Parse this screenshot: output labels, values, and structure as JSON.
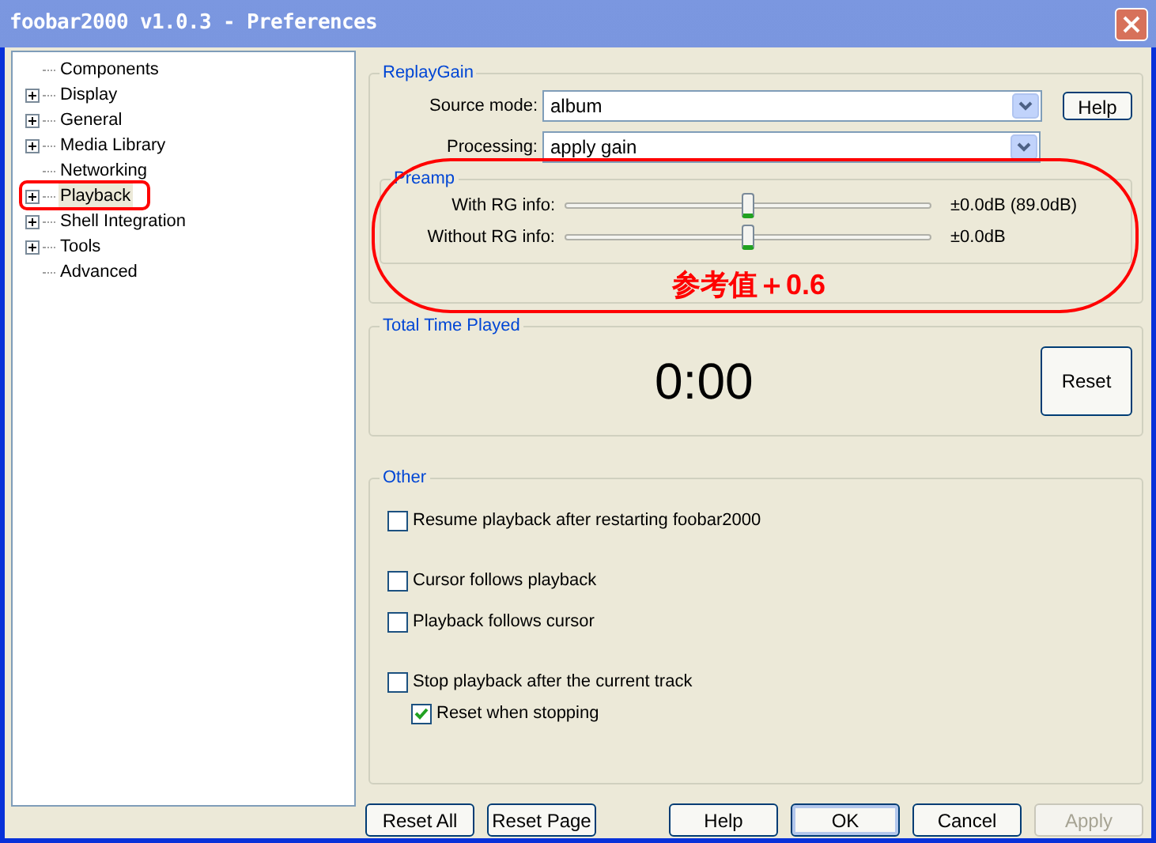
{
  "window": {
    "title": "foobar2000 v1.0.3 - Preferences"
  },
  "tree": [
    {
      "label": "Components",
      "expandable": false,
      "selected": false
    },
    {
      "label": "Display",
      "expandable": true,
      "selected": false
    },
    {
      "label": "General",
      "expandable": true,
      "selected": false
    },
    {
      "label": "Media Library",
      "expandable": true,
      "selected": false
    },
    {
      "label": "Networking",
      "expandable": false,
      "selected": false
    },
    {
      "label": "Playback",
      "expandable": true,
      "selected": true
    },
    {
      "label": "Shell Integration",
      "expandable": true,
      "selected": false
    },
    {
      "label": "Tools",
      "expandable": true,
      "selected": false
    },
    {
      "label": "Advanced",
      "expandable": false,
      "selected": false
    }
  ],
  "replaygain": {
    "title": "ReplayGain",
    "source_mode": {
      "label": "Source mode:",
      "value": "album"
    },
    "help": "Help",
    "processing": {
      "label": "Processing:",
      "value": "apply gain"
    },
    "preamp": {
      "title": "Preamp",
      "sliders": [
        {
          "label": "With RG info:",
          "level": 0.5,
          "reading": "±0.0dB (89.0dB)"
        },
        {
          "label": "Without RG info:",
          "level": 0.5,
          "reading": "±0.0dB"
        }
      ]
    }
  },
  "total_time": {
    "title": "Total Time Played",
    "value": "0:00",
    "reset": "Reset"
  },
  "other": {
    "title": "Other",
    "options": [
      {
        "label": "Resume playback after restarting foobar2000",
        "checked": false
      },
      {
        "label": "Cursor follows playback",
        "checked": false
      },
      {
        "label": "Playback follows cursor",
        "checked": false
      },
      {
        "label": "Stop playback after the current track",
        "checked": false,
        "children": [
          {
            "label": "Reset when stopping",
            "checked": true
          }
        ]
      }
    ]
  },
  "buttons": [
    {
      "label": "Reset All",
      "disabled": false
    },
    {
      "label": "Reset Page",
      "disabled": false
    },
    {
      "label": "Help",
      "disabled": false
    },
    {
      "label": "OK",
      "disabled": false
    },
    {
      "label": "Cancel",
      "disabled": false
    },
    {
      "label": "Apply",
      "disabled": true
    }
  ],
  "annotation": {
    "note": "参考值＋0.6"
  }
}
